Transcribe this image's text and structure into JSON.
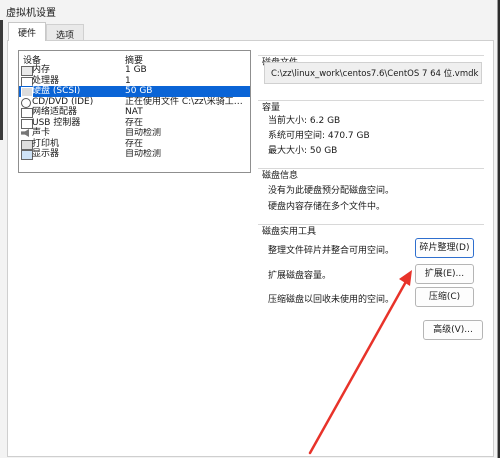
{
  "window": {
    "title": "虚拟机设置"
  },
  "tabs": [
    {
      "label": "硬件",
      "active": true
    },
    {
      "label": "选项",
      "active": false
    }
  ],
  "device_list": {
    "headers": {
      "device": "设备",
      "summary": "摘要"
    },
    "rows": [
      {
        "icon": "memory-icon",
        "name": "内存",
        "summary": "1 GB",
        "selected": false
      },
      {
        "icon": "processor-icon",
        "name": "处理器",
        "summary": "1",
        "selected": false
      },
      {
        "icon": "hard-disk-icon",
        "name": "硬盘 (SCSI)",
        "summary": "50 GB",
        "selected": true
      },
      {
        "icon": "cd-dvd-icon",
        "name": "CD/DVD (IDE)",
        "summary": "正在使用文件 C:\\zz\\米骑工作...",
        "selected": false
      },
      {
        "icon": "network-adapter-icon",
        "name": "网络适配器",
        "summary": "NAT",
        "selected": false
      },
      {
        "icon": "usb-controller-icon",
        "name": "USB 控制器",
        "summary": "存在",
        "selected": false
      },
      {
        "icon": "sound-card-icon",
        "name": "声卡",
        "summary": "自动检测",
        "selected": false
      },
      {
        "icon": "printer-icon",
        "name": "打印机",
        "summary": "存在",
        "selected": false
      },
      {
        "icon": "display-icon",
        "name": "显示器",
        "summary": "自动检测",
        "selected": false
      }
    ]
  },
  "disk_file": {
    "label": "磁盘文件",
    "path": "C:\\zz\\linux_work\\centos7.6\\CentOS 7 64 位.vmdk"
  },
  "capacity": {
    "label": "容量",
    "current_size": "当前大小: 6.2 GB",
    "system_free": "系统可用空间: 470.7 GB",
    "max_size": "最大大小: 50 GB"
  },
  "disk_info": {
    "label": "磁盘信息",
    "line1": "没有为此硬盘预分配磁盘空间。",
    "line2": "硬盘内容存储在多个文件中。"
  },
  "disk_utilities": {
    "label": "磁盘实用工具",
    "defrag_text": "整理文件碎片并整合可用空间。",
    "defrag_button": "碎片整理(D)",
    "expand_text": "扩展磁盘容量。",
    "expand_button": "扩展(E)...",
    "compact_text": "压缩磁盘以回收未使用的空间。",
    "compact_button": "压缩(C)"
  },
  "advanced_button": "高级(V)...",
  "colors": {
    "selection": "#0a64d6",
    "annotation_arrow": "#e8332a",
    "focus_border": "#2f6fce"
  }
}
